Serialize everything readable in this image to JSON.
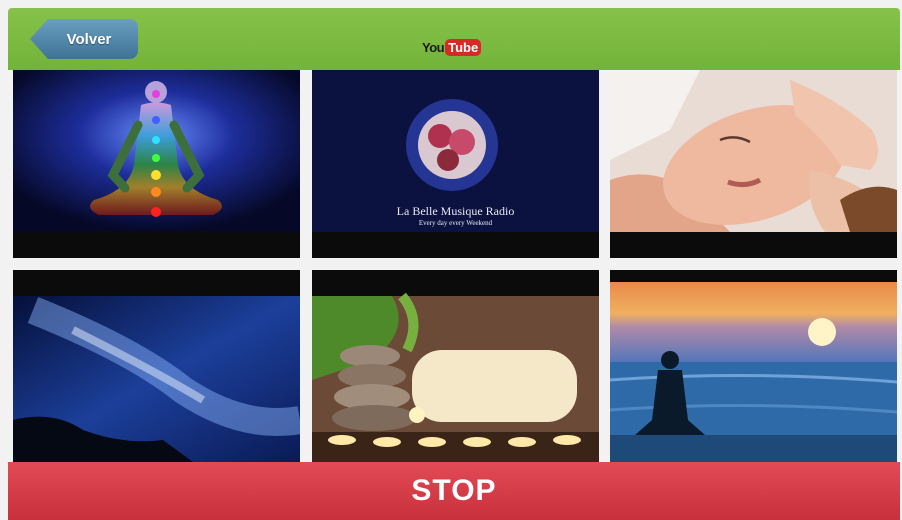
{
  "header": {
    "back_label": "Volver",
    "logo_you": "You",
    "logo_tube": "Tube"
  },
  "videos": [
    {
      "title": "",
      "image": "chakra-meditation"
    },
    {
      "title": "La Belle Musique Radio",
      "subtitle": "Every day every Weekend",
      "image": "radio-logo"
    },
    {
      "title": "",
      "image": "face-massage"
    },
    {
      "title": "",
      "image": "milky-way-sky"
    },
    {
      "title": "",
      "image": "spa-stones-candles"
    },
    {
      "title": "",
      "image": "sunset-meditation"
    }
  ],
  "footer": {
    "stop_label": "STOP"
  },
  "colors": {
    "header_green": "#7ab940",
    "back_blue": "#4f86aa",
    "stop_red": "#d63a45"
  }
}
